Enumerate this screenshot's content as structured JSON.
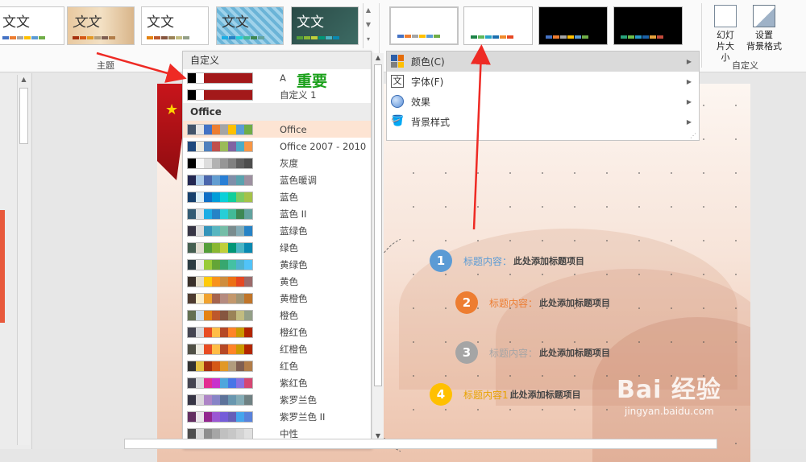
{
  "ribbon": {
    "theme_thumbs": [
      "文文",
      "文文",
      "文文",
      "文文",
      "文文"
    ],
    "theme_group_label": "主题",
    "custom_group_label": "自定义",
    "slide_size_label": "幻灯片大小",
    "bg_format_label_1": "设置",
    "bg_format_label_2": "背景格式"
  },
  "colormenu": {
    "header_custom": "自定义",
    "custom_items": [
      {
        "name": "A",
        "colors": [
          "#000000",
          "#ffffff",
          "#a3191a",
          "#a3191a",
          "#a3191a",
          "#a3191a",
          "#a3191a",
          "#a3191a"
        ]
      },
      {
        "name": "自定义 1",
        "colors": [
          "#000000",
          "#ffffff",
          "#a3191a",
          "#a3191a",
          "#a3191a",
          "#a3191a",
          "#a3191a",
          "#a3191a"
        ]
      }
    ],
    "annotation": "重要",
    "header_office": "Office",
    "items": [
      {
        "name": "Office",
        "colors": [
          "#44546a",
          "#e7e6e6",
          "#4472c4",
          "#ed7d31",
          "#a5a5a5",
          "#ffc000",
          "#5b9bd5",
          "#70ad47"
        ]
      },
      {
        "name": "Office 2007 - 2010",
        "colors": [
          "#1f497d",
          "#eeece1",
          "#4f81bd",
          "#c0504d",
          "#9bbb59",
          "#8064a2",
          "#4bacc6",
          "#f79646"
        ]
      },
      {
        "name": "灰度",
        "colors": [
          "#000000",
          "#f8f8f8",
          "#dddddd",
          "#b2b2b2",
          "#969696",
          "#808080",
          "#5f5f5f",
          "#4d4d4d"
        ]
      },
      {
        "name": "蓝色暖调",
        "colors": [
          "#242852",
          "#acccea",
          "#4a66ac",
          "#629dd1",
          "#297fd5",
          "#7f8fa9",
          "#5aa2ae",
          "#9d90a0"
        ]
      },
      {
        "name": "蓝色",
        "colors": [
          "#17406d",
          "#dbeff9",
          "#0f6fc6",
          "#009dd9",
          "#0bd0d9",
          "#10cf9b",
          "#7cca62",
          "#a5c249"
        ]
      },
      {
        "name": "蓝色 II",
        "colors": [
          "#335b74",
          "#dfe3e5",
          "#1cade4",
          "#2683c6",
          "#27ced7",
          "#42ba97",
          "#3e8853",
          "#62a39f"
        ]
      },
      {
        "name": "蓝绿色",
        "colors": [
          "#373545",
          "#dedede",
          "#3494ba",
          "#58b6c0",
          "#75bda7",
          "#7a8c8e",
          "#84acb6",
          "#2683c6"
        ]
      },
      {
        "name": "绿色",
        "colors": [
          "#455f51",
          "#e3ded1",
          "#549e39",
          "#8ab833",
          "#c0cf3a",
          "#029676",
          "#4ab5c4",
          "#0989b1"
        ]
      },
      {
        "name": "黄绿色",
        "colors": [
          "#2c3c43",
          "#ebebeb",
          "#99cb38",
          "#63a537",
          "#37a76f",
          "#44c1a3",
          "#4eb3cf",
          "#51c3f9"
        ]
      },
      {
        "name": "黄色",
        "colors": [
          "#39302a",
          "#e5dec9",
          "#ffca08",
          "#f8931d",
          "#ce8d3e",
          "#ec7016",
          "#e64823",
          "#9c6a6a"
        ]
      },
      {
        "name": "黄橙色",
        "colors": [
          "#4e3b30",
          "#fbeec9",
          "#f0a22e",
          "#a5644e",
          "#b58b80",
          "#c3986d",
          "#a19574",
          "#c17529"
        ]
      },
      {
        "name": "橙色",
        "colors": [
          "#637052",
          "#ccddea",
          "#e48312",
          "#bd582c",
          "#865640",
          "#9b8357",
          "#c2bc80",
          "#94a088"
        ]
      },
      {
        "name": "橙红色",
        "colors": [
          "#454551",
          "#d8d9dc",
          "#e84c22",
          "#ffbd47",
          "#b64926",
          "#ff8427",
          "#cc9900",
          "#b22600"
        ]
      },
      {
        "name": "红橙色",
        "colors": [
          "#505046",
          "#eeece1",
          "#e84c22",
          "#ffbd47",
          "#b64926",
          "#ff8427",
          "#cc9900",
          "#b22600"
        ]
      },
      {
        "name": "红色",
        "colors": [
          "#323232",
          "#e5c243",
          "#a5300f",
          "#d55816",
          "#e19825",
          "#b19c7d",
          "#7f5f52",
          "#b27d49"
        ]
      },
      {
        "name": "紫红色",
        "colors": [
          "#454551",
          "#d8d9dc",
          "#e32d91",
          "#c830cc",
          "#4ea6dc",
          "#4775e7",
          "#8971e1",
          "#d54773"
        ]
      },
      {
        "name": "紫罗兰色",
        "colors": [
          "#373545",
          "#dcd8dc",
          "#ad84c6",
          "#8784c7",
          "#5d739a",
          "#6997af",
          "#84acb6",
          "#6f8183"
        ]
      },
      {
        "name": "紫罗兰色 II",
        "colors": [
          "#632e62",
          "#eae5eb",
          "#92278f",
          "#9b57d3",
          "#755dd9",
          "#665eb8",
          "#45a5ed",
          "#5982db"
        ]
      },
      {
        "name": "中性",
        "colors": [
          "#4d4d4d",
          "#d8d8d8",
          "#8e8e8e",
          "#a6a6a6",
          "#c0c0c0",
          "#c7c7c7",
          "#d3d3d3",
          "#e0e0e0"
        ]
      }
    ]
  },
  "optmenu": {
    "items": [
      "颜色(C)",
      "字体(F)",
      "效果",
      "背景样式"
    ]
  },
  "slide": {
    "items": [
      {
        "num": "1",
        "label": "标题内容：",
        "text": "此处添加标题项目",
        "color": "#5b9bd5",
        "label_color": "#5b9bd5"
      },
      {
        "num": "2",
        "label": "标题内容：",
        "text": "此处添加标题项目",
        "color": "#ed7d31",
        "label_color": "#ed7d31"
      },
      {
        "num": "3",
        "label": "标题内容：",
        "text": "此处添加标题项目",
        "color": "#a5a5a5",
        "label_color": "#a5a5a5"
      },
      {
        "num": "4",
        "label": "标题内容1",
        "text": "此处添加标题项目",
        "color": "#ffc000",
        "label_color": "#e8a200"
      }
    ],
    "watermark_main": "Bai 经验",
    "watermark_url": "jingyan.baidu.com"
  },
  "colors": {
    "arrow": "#ee2a24",
    "annotation": "#1aa01a",
    "accent": "#d24726"
  }
}
